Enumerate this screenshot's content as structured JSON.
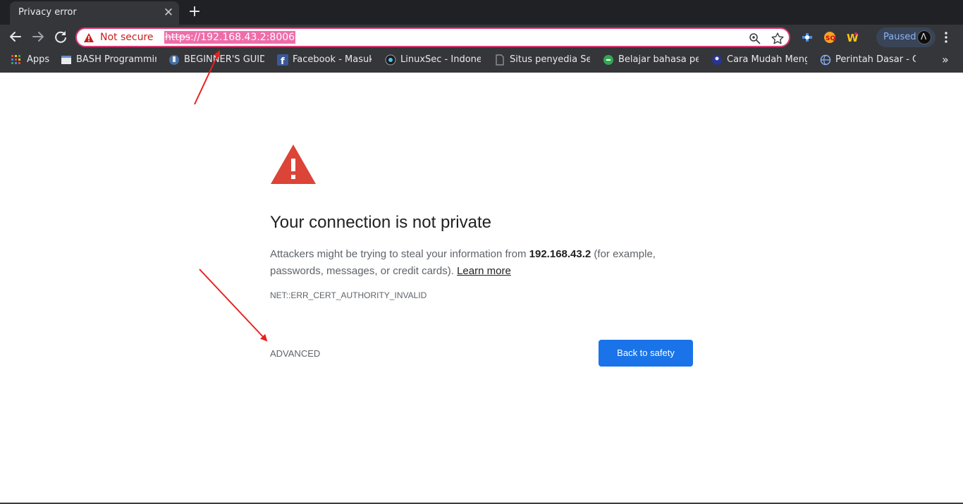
{
  "tab": {
    "title": "Privacy error",
    "close_glyph": "✕",
    "new_tab_glyph": "+"
  },
  "omnibox": {
    "security_label": "Not secure",
    "url_scheme": "https",
    "url_rest": "://192.168.43.2:8006"
  },
  "profile": {
    "status": "Paused",
    "avatar_glyph": "Λ"
  },
  "bookmarks": [
    {
      "label": "Apps",
      "icon": "apps-grid-icon"
    },
    {
      "label": "BASH Programmin",
      "icon": "page-icon"
    },
    {
      "label": "BEGINNER'S GUIDE",
      "icon": "bookmark-icon"
    },
    {
      "label": "Facebook - Masuk",
      "icon": "facebook-icon"
    },
    {
      "label": "LinuxSec - Indones",
      "icon": "linuxsec-icon"
    },
    {
      "label": "Situs penyedia Sert",
      "icon": "blank-page-icon"
    },
    {
      "label": "Belajar bahasa pen",
      "icon": "green-circle-icon"
    },
    {
      "label": "Cara Mudah Meng",
      "icon": "site-icon"
    },
    {
      "label": "Perintah Dasar - Co",
      "icon": "globe-icon"
    }
  ],
  "bookmarks_more": "»",
  "error_page": {
    "heading": "Your connection is not private",
    "desc_before": "Attackers might be trying to steal your information from ",
    "host": "192.168.43.2",
    "desc_after": " (for example, passwords, messages, or credit cards). ",
    "learn_more": "Learn more",
    "error_code": "NET::ERR_CERT_AUTHORITY_INVALID",
    "advanced_label": "ADVANCED",
    "back_button": "Back to safety"
  },
  "colors": {
    "chrome_dark": "#202124",
    "toolbar": "#35363a",
    "warning_red": "#db4437",
    "not_secure_red": "#c5221f",
    "primary_blue": "#1a73e8",
    "annotation_red": "#e8211e",
    "url_highlight": "#ee6da9"
  }
}
